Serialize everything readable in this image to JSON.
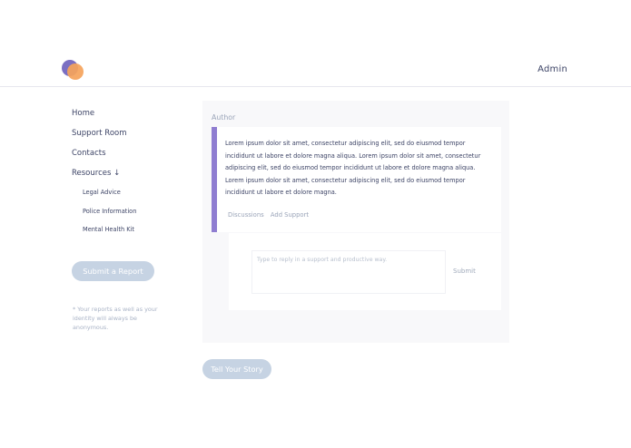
{
  "header": {
    "user_label": "Admin"
  },
  "sidebar": {
    "items": [
      {
        "label": "Home"
      },
      {
        "label": "Support Room"
      },
      {
        "label": "Contacts"
      },
      {
        "label": "Resources ↓"
      }
    ],
    "sub_items": [
      {
        "label": "Legal Advice"
      },
      {
        "label": "Police Information"
      },
      {
        "label": "Mental Health Kit"
      }
    ],
    "submit_report_label": "Submit a Report",
    "anon_note": "* Your reports as well as your identity will always be anonymous."
  },
  "post": {
    "author": "Author",
    "body": "Lorem ipsum dolor sit amet, consectetur adipiscing elit, sed do eiusmod tempor incididunt ut labore et dolore magna aliqua. Lorem ipsum dolor sit amet, consectetur adipiscing elit, sed do eiusmod tempor incididunt ut labore et dolore magna aliqua. Lorem ipsum dolor sit amet, consectetur adipiscing elit, sed do eiusmod tempor incididunt ut labore et dolore magna.",
    "actions": {
      "discussions": "Discussions",
      "add_support": "Add Support"
    }
  },
  "reply": {
    "placeholder": "Type to reply in a support and productive way.",
    "submit_label": "Submit"
  },
  "tell_story_label": "Tell Your Story",
  "colors": {
    "accent_purple": "#8f7dd1",
    "logo_purple": "#7b6fc2",
    "logo_orange": "#f5a35b",
    "button_bg": "#c6d3e3",
    "text_dark": "#3d4466",
    "text_muted": "#9aa4b8"
  }
}
